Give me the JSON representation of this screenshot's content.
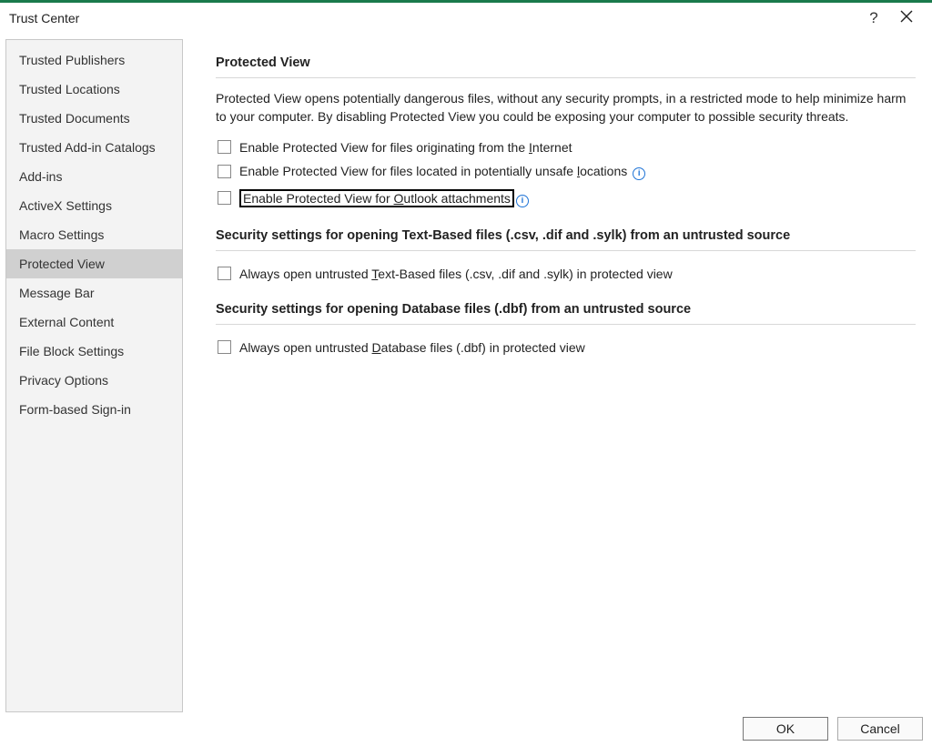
{
  "titlebar": {
    "title": "Trust Center",
    "help_symbol": "?"
  },
  "sidebar": {
    "items": [
      "Trusted Publishers",
      "Trusted Locations",
      "Trusted Documents",
      "Trusted Add-in Catalogs",
      "Add-ins",
      "ActiveX Settings",
      "Macro Settings",
      "Protected View",
      "Message Bar",
      "External Content",
      "File Block Settings",
      "Privacy Options",
      "Form-based Sign-in"
    ],
    "selected_index": 7
  },
  "main": {
    "protected_view": {
      "heading": "Protected View",
      "description": "Protected View opens potentially dangerous files, without any security prompts, in a restricted mode to help minimize harm to your computer. By disabling Protected View you could be exposing your computer to possible security threats.",
      "options": {
        "opt1_pre": "Enable Protected View for files originating from the ",
        "opt1_hk": "I",
        "opt1_post": "nternet",
        "opt2_pre": "Enable Protected View for files located in potentially unsafe ",
        "opt2_hk": "l",
        "opt2_post": "ocations",
        "opt3_pre": "Enable Protected View for ",
        "opt3_hk": "O",
        "opt3_post": "utlook attachments"
      }
    },
    "text_based": {
      "heading": "Security settings for opening Text-Based files (.csv, .dif and .sylk) from an untrusted source",
      "opt_pre": "Always open untrusted ",
      "opt_hk": "T",
      "opt_post": "ext-Based files (.csv, .dif and .sylk) in protected view"
    },
    "database": {
      "heading": "Security settings for opening Database files (.dbf) from an untrusted source",
      "opt_pre": "Always open untrusted ",
      "opt_hk": "D",
      "opt_post": "atabase files (.dbf) in protected view"
    }
  },
  "footer": {
    "ok": "OK",
    "cancel": "Cancel"
  },
  "info_symbol": "i"
}
